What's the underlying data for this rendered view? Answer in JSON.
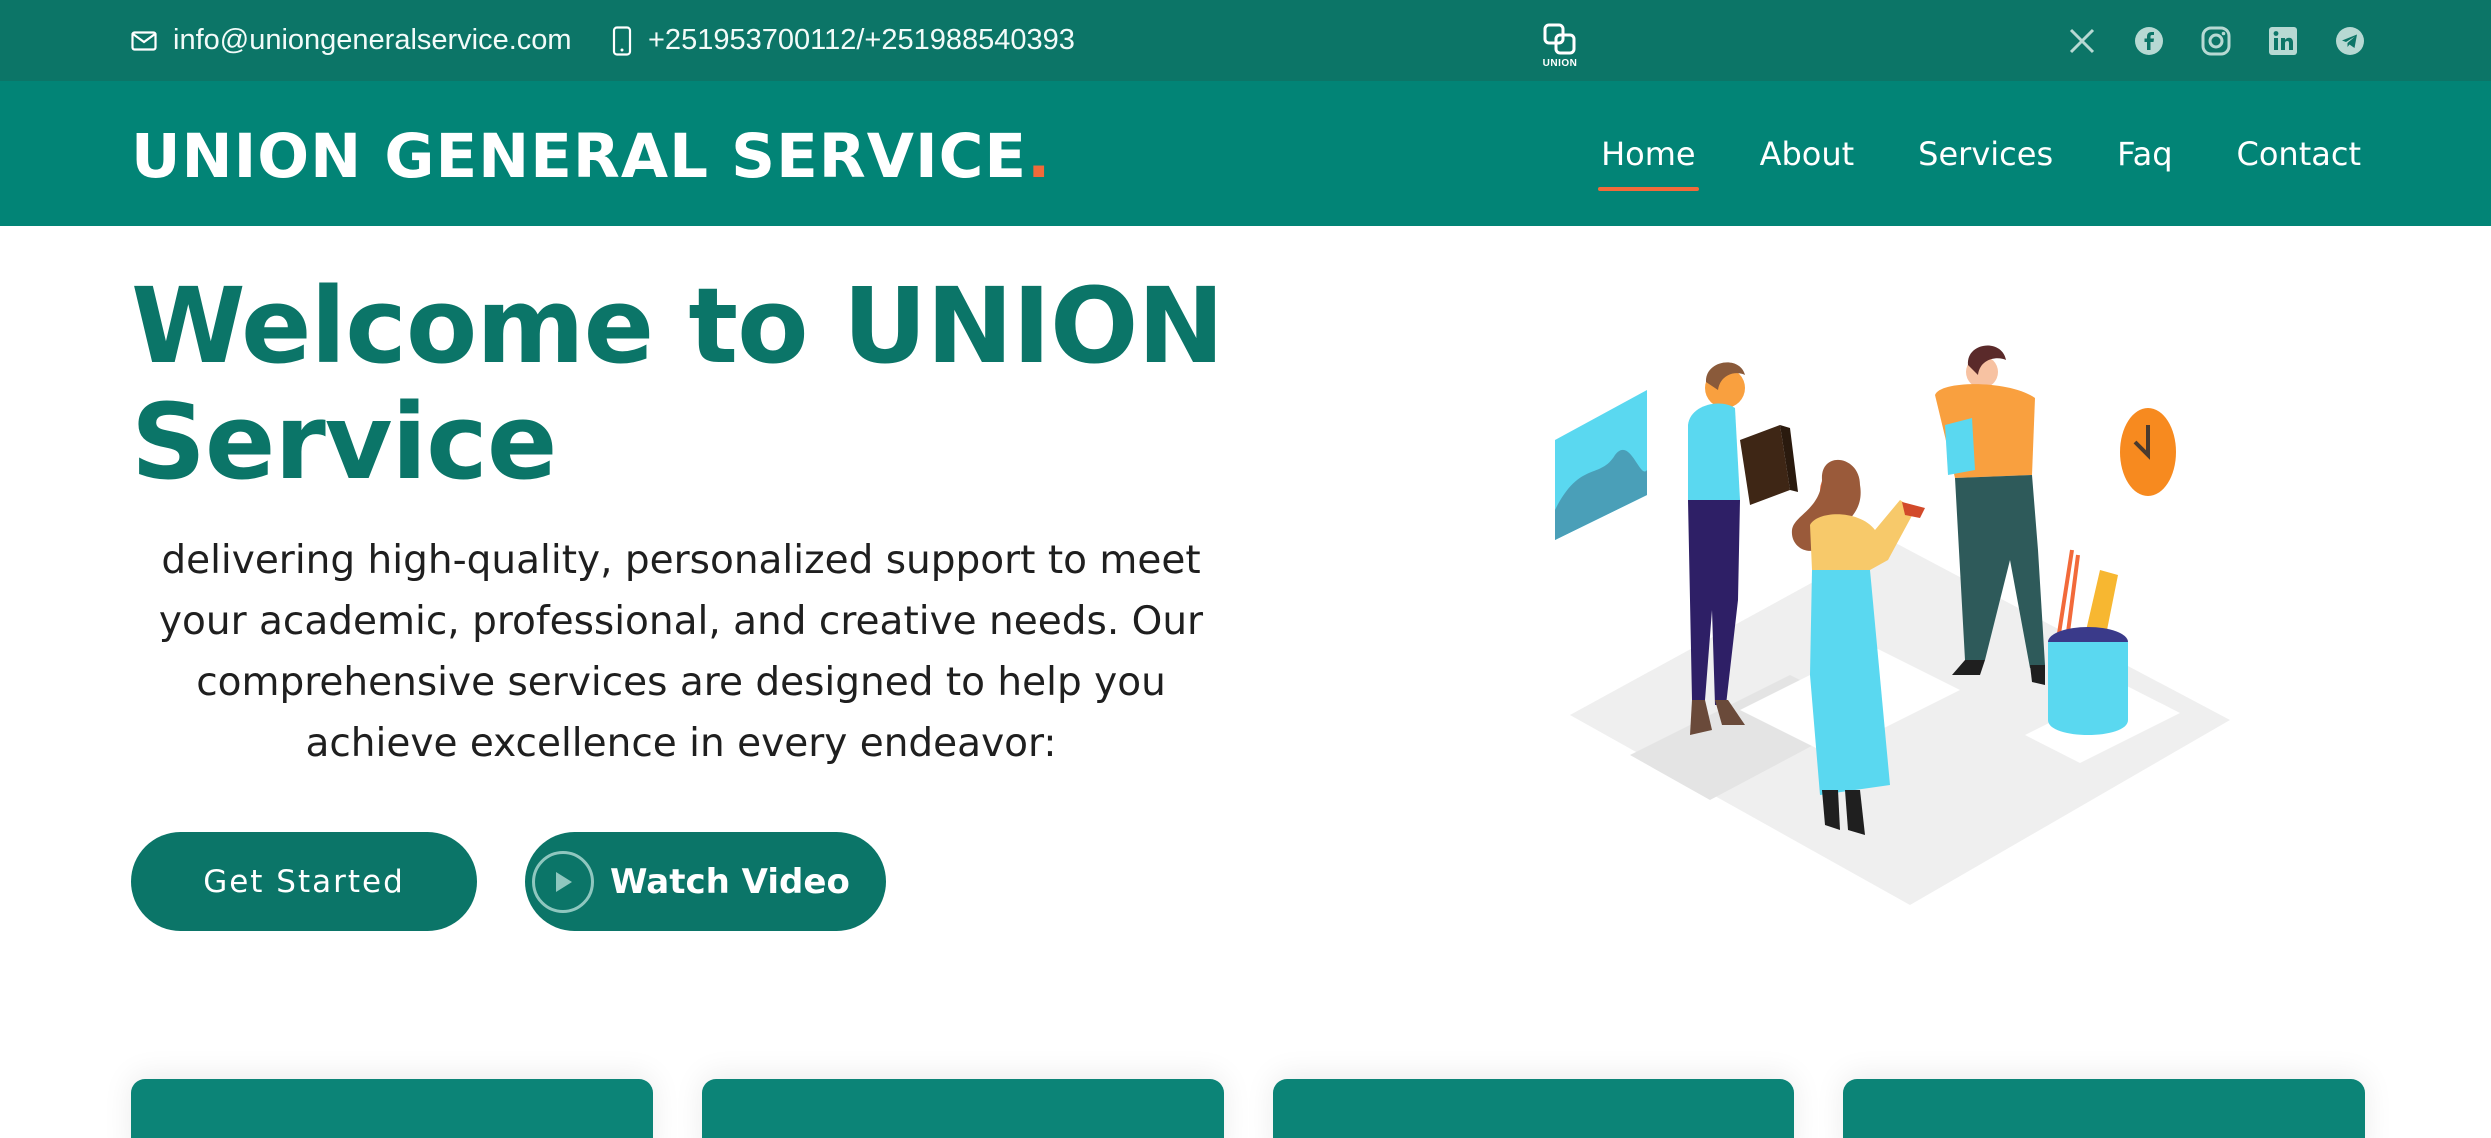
{
  "topbar": {
    "email": "info@uniongeneralservice.com",
    "phone": "+251953700112/+251988540393",
    "logo_caption": "UNION",
    "social": [
      "x-icon",
      "facebook-icon",
      "instagram-icon",
      "linkedin-icon",
      "telegram-icon"
    ]
  },
  "header": {
    "brand": "UNION GENERAL SERVICE",
    "brand_dot": ".",
    "nav": [
      {
        "label": "Home",
        "active": true
      },
      {
        "label": "About",
        "active": false
      },
      {
        "label": "Services",
        "active": false
      },
      {
        "label": "Faq",
        "active": false
      },
      {
        "label": "Contact",
        "active": false
      }
    ]
  },
  "hero": {
    "title": "Welcome to UNION Service",
    "description": "delivering high-quality, personalized support to meet your academic, professional, and creative needs. Our comprehensive services are designed to help you achieve excellence in every endeavor:",
    "primary_button": "Get Started",
    "video_button": "Watch Video"
  },
  "colors": {
    "topbar": "#0c7567",
    "header": "#028476",
    "accent": "#f26a3a",
    "title": "#0b7568"
  }
}
